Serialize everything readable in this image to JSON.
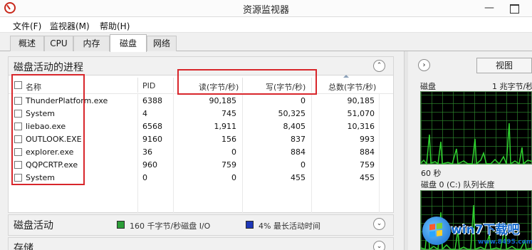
{
  "window": {
    "title": "资源监视器",
    "minimize_glyph": "—",
    "close_glyph": ""
  },
  "menu": {
    "items": [
      "文件(F)",
      "监视器(M)",
      "帮助(H)"
    ]
  },
  "tabs": [
    {
      "label": "概述",
      "active": false
    },
    {
      "label": "CPU",
      "active": false
    },
    {
      "label": "内存",
      "active": false
    },
    {
      "label": "磁盘",
      "active": true
    },
    {
      "label": "网络",
      "active": false
    }
  ],
  "processes": {
    "title": "磁盘活动的进程",
    "collapse_glyph": "⌃",
    "columns": {
      "name": "名称",
      "pid": "PID",
      "read": "读(字节/秒)",
      "write": "写(字节/秒)",
      "total": "总数(字节/秒)"
    },
    "rows": [
      {
        "name": "ThunderPlatform.exe",
        "pid": "6388",
        "read": "90,185",
        "write": "0",
        "total": "90,185"
      },
      {
        "name": "System",
        "pid": "4",
        "read": "745",
        "write": "50,325",
        "total": "51,070"
      },
      {
        "name": "liebao.exe",
        "pid": "6568",
        "read": "1,911",
        "write": "8,405",
        "total": "10,316"
      },
      {
        "name": "OUTLOOK.EXE",
        "pid": "9160",
        "read": "156",
        "write": "837",
        "total": "993"
      },
      {
        "name": "explorer.exe",
        "pid": "36",
        "read": "0",
        "write": "884",
        "total": "884"
      },
      {
        "name": "QQPCRTP.exe",
        "pid": "960",
        "read": "759",
        "write": "0",
        "total": "759"
      },
      {
        "name": "System",
        "pid": "0",
        "read": "0",
        "write": "455",
        "total": "455"
      }
    ]
  },
  "disk_activity": {
    "title": "磁盘活动",
    "io_label": "160 千字节/秒磁盘 I/O",
    "active_label": "4% 最长活动时间",
    "io_color": "#2c9e38",
    "active_color": "#1e37b8",
    "expand_glyph": "⌄"
  },
  "storage": {
    "title": "存储"
  },
  "right_pane": {
    "nav_glyph": "›",
    "view_label": "视图",
    "disk_label": "磁盘",
    "rate_label": "1 兆字节/秒",
    "seconds_label": "60 秒",
    "queue_label": "磁盘 0 (C:) 队列长度"
  },
  "watermark": {
    "text": "win7下载吧",
    "url": "www.8495.com"
  }
}
